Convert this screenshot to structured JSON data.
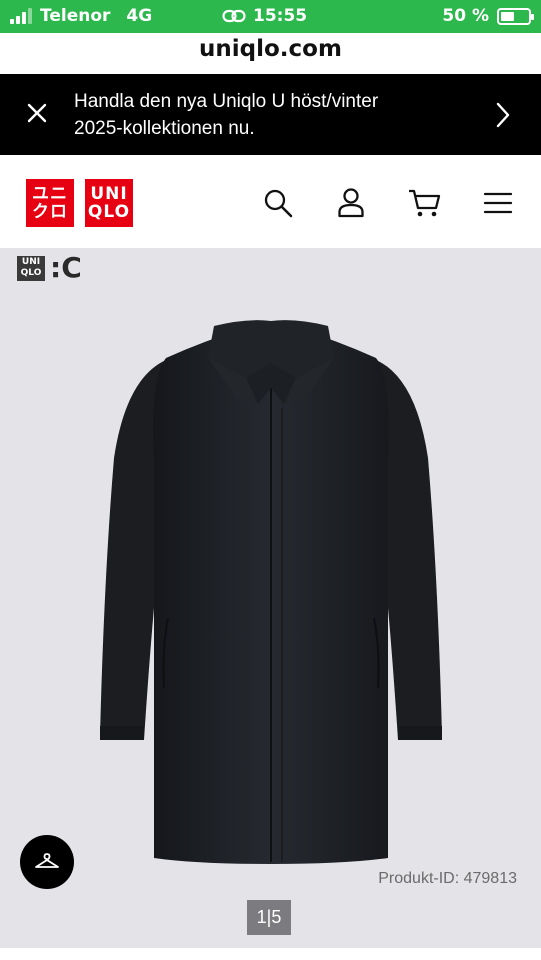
{
  "status_bar": {
    "carrier": "Telenor",
    "network": "4G",
    "time": "15:55",
    "battery": "50 %",
    "battery_level": 0.5,
    "background_color": "#2db84d"
  },
  "browser": {
    "url": "uniqlo.com"
  },
  "promo_banner": {
    "line1": "Handla den nya Uniqlo U höst/vinter",
    "line2": "2025-kollektionen nu.",
    "close_icon": "close-icon",
    "next_icon": "chevron-right-icon"
  },
  "header": {
    "logo_katakana": [
      "ユニ",
      "クロ"
    ],
    "logo_latin": [
      "UNI",
      "QLO"
    ],
    "brand_color": "#e60012",
    "icons": [
      "search-icon",
      "account-icon",
      "cart-icon",
      "menu-icon"
    ]
  },
  "gallery": {
    "collab_badge_top": "UNI",
    "collab_badge_bottom": "QLO",
    "collab_mark": ":C",
    "product_id": "Produkt-ID: 479813",
    "pager": "1|5",
    "fab_icon": "hanger-icon",
    "background_color": "#e4e4e8"
  }
}
